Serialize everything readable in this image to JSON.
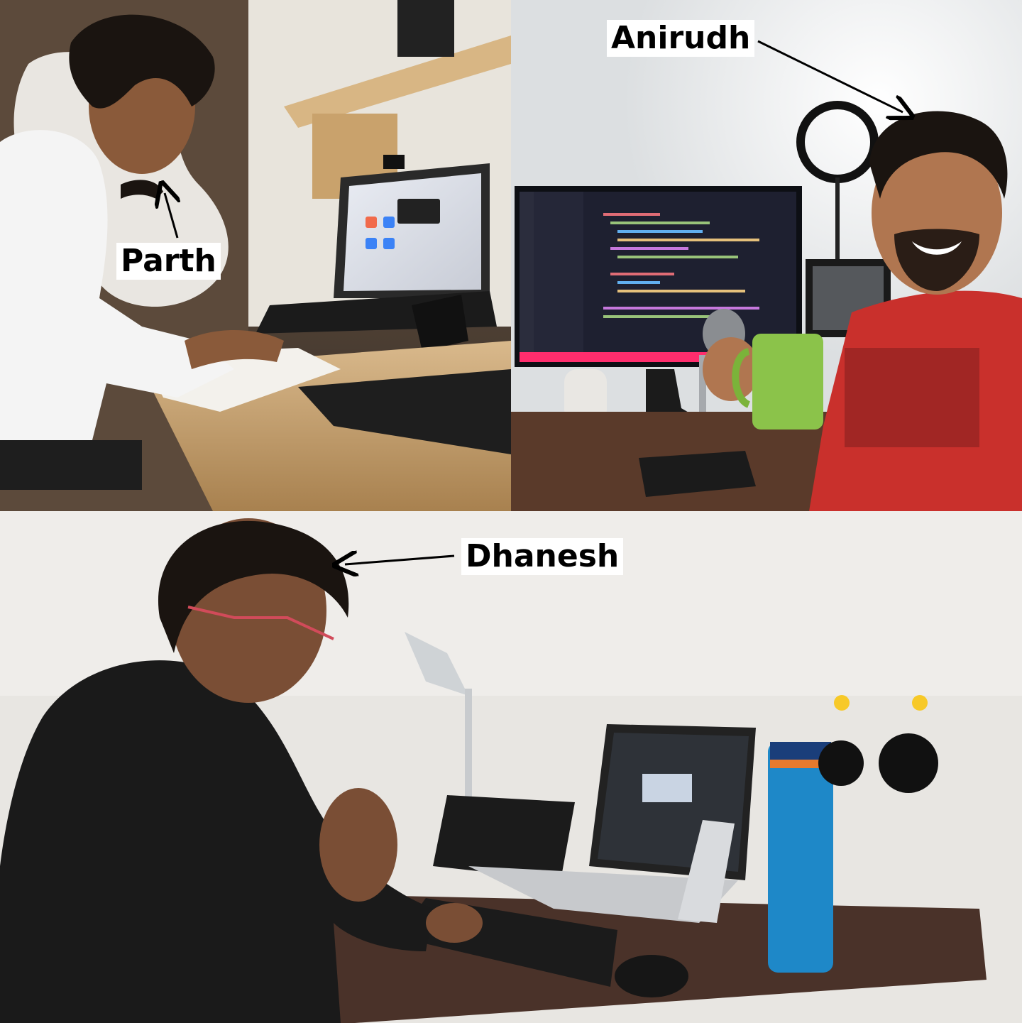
{
  "labels": {
    "parth": "Parth",
    "anirudh": "Anirudh",
    "dhanesh": "Dhanesh"
  },
  "colors": {
    "label_background": "#ffffff",
    "label_text": "#000000",
    "anirudh_shirt": "#c9302c",
    "mug": "#8bc34a",
    "water_bottle": "#1e88c8",
    "hoodie": "#1a1a1a"
  },
  "icons": {
    "arrow": "arrow-icon",
    "emoji": "smiley-icon"
  }
}
